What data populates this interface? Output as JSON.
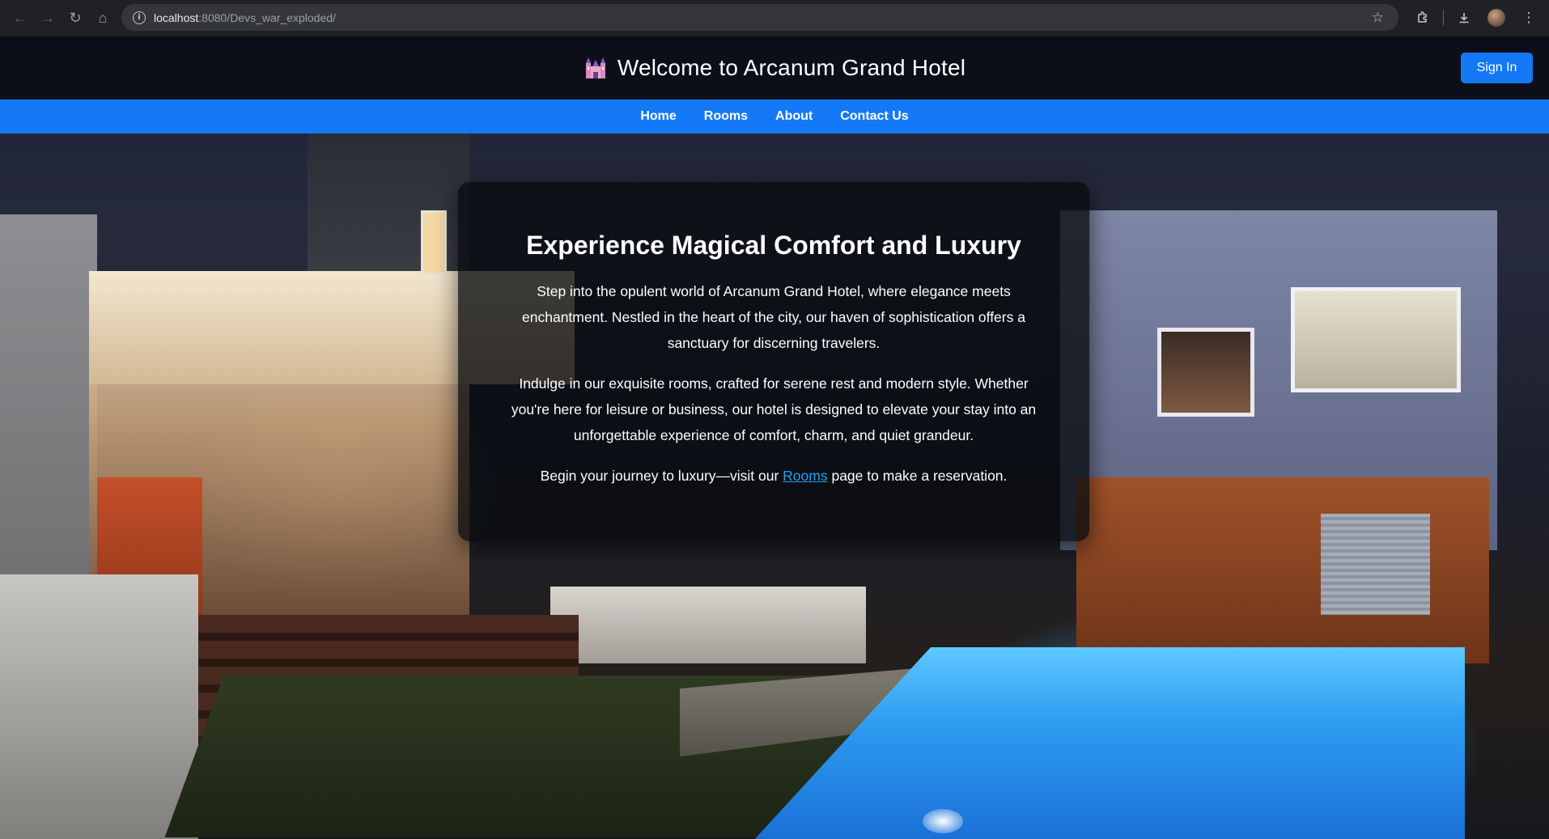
{
  "browser": {
    "url_host": "localhost",
    "url_path": ":8080/Devs_war_exploded/"
  },
  "header": {
    "title": "Welcome to Arcanum Grand Hotel",
    "logo_icon": "castle-icon",
    "signin_label": "Sign In",
    "accent_color": "#1479f6"
  },
  "nav": {
    "items": [
      {
        "label": "Home"
      },
      {
        "label": "Rooms"
      },
      {
        "label": "About"
      },
      {
        "label": "Contact Us"
      }
    ]
  },
  "hero": {
    "heading": "Experience Magical Comfort and Luxury",
    "paragraph1": "Step into the opulent world of Arcanum Grand Hotel, where elegance meets enchantment. Nestled in the heart of the city, our haven of sophistication offers a sanctuary for discerning travelers.",
    "paragraph2": "Indulge in our exquisite rooms, crafted for serene rest and modern style. Whether you're here for leisure or business, our hotel is designed to elevate your stay into an unforgettable experience of comfort, charm, and quiet grandeur.",
    "cta_before": "Begin your journey to luxury—visit our ",
    "cta_link": "Rooms",
    "cta_after": " page to make a reservation."
  }
}
